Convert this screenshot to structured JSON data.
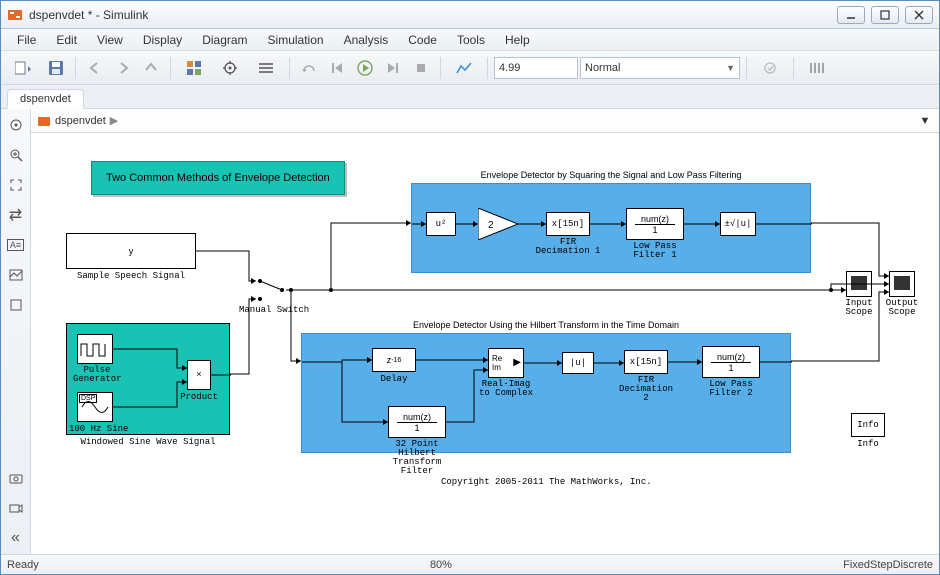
{
  "window": {
    "title": "dspenvdet * - Simulink"
  },
  "menu": {
    "file": "File",
    "edit": "Edit",
    "view": "View",
    "display": "Display",
    "diagram": "Diagram",
    "simulation": "Simulation",
    "analysis": "Analysis",
    "code": "Code",
    "tools": "Tools",
    "help": "Help"
  },
  "toolbar": {
    "stop_time": "4.99",
    "mode": "Normal"
  },
  "tabs": {
    "tab1": "dspenvdet"
  },
  "breadcrumb": {
    "model": "dspenvdet"
  },
  "status": {
    "left": "Ready",
    "zoom": "80%",
    "solver": "FixedStepDiscrete"
  },
  "diagram": {
    "title": "Two Common Methods of Envelope Detection",
    "speech_block": "y",
    "speech_label": "Sample Speech Signal",
    "pulse_label": "Pulse\nGenerator",
    "dsp_badge": "DSP",
    "sine_label": "100 Hz Sine",
    "product_label": "Product",
    "windowed_label": "Windowed Sine Wave Signal",
    "switch_label": "Manual Switch",
    "region1_title": "Envelope Detector by Squaring the Signal and Low Pass Filtering",
    "sq_block": "u²",
    "gain_block": "2",
    "dec1_block": "x[15n]",
    "dec1_label": "FIR\nDecimation 1",
    "lp1_top": "num(z)",
    "lp1_bot": "1",
    "lp1_label": "Low Pass\nFilter 1",
    "sqrt_block": "±√|u|",
    "region2_title": "Envelope Detector Using the Hilbert Transform in the Time Domain",
    "delay_block": "z",
    "delay_exp": "-16",
    "delay_label": "Delay",
    "ri_top": "Re",
    "ri_bot": "Im",
    "ri_label": "Real-Imag to\nComplex",
    "abs_block": "|u|",
    "dec2_block": "x[15n]",
    "dec2_label": "FIR\nDecimation 2",
    "lp2_top": "num(z)",
    "lp2_bot": "1",
    "lp2_label": "Low Pass\nFilter 2",
    "hilbert_top": "num(z)",
    "hilbert_bot": "1",
    "hilbert_label": "32 Point Hilbert\nTransform Filter",
    "input_scope": "Input\nScope",
    "output_scope": "Output\nScope",
    "info": "Info",
    "copyright": "Copyright 2005-2011 The MathWorks, Inc."
  }
}
